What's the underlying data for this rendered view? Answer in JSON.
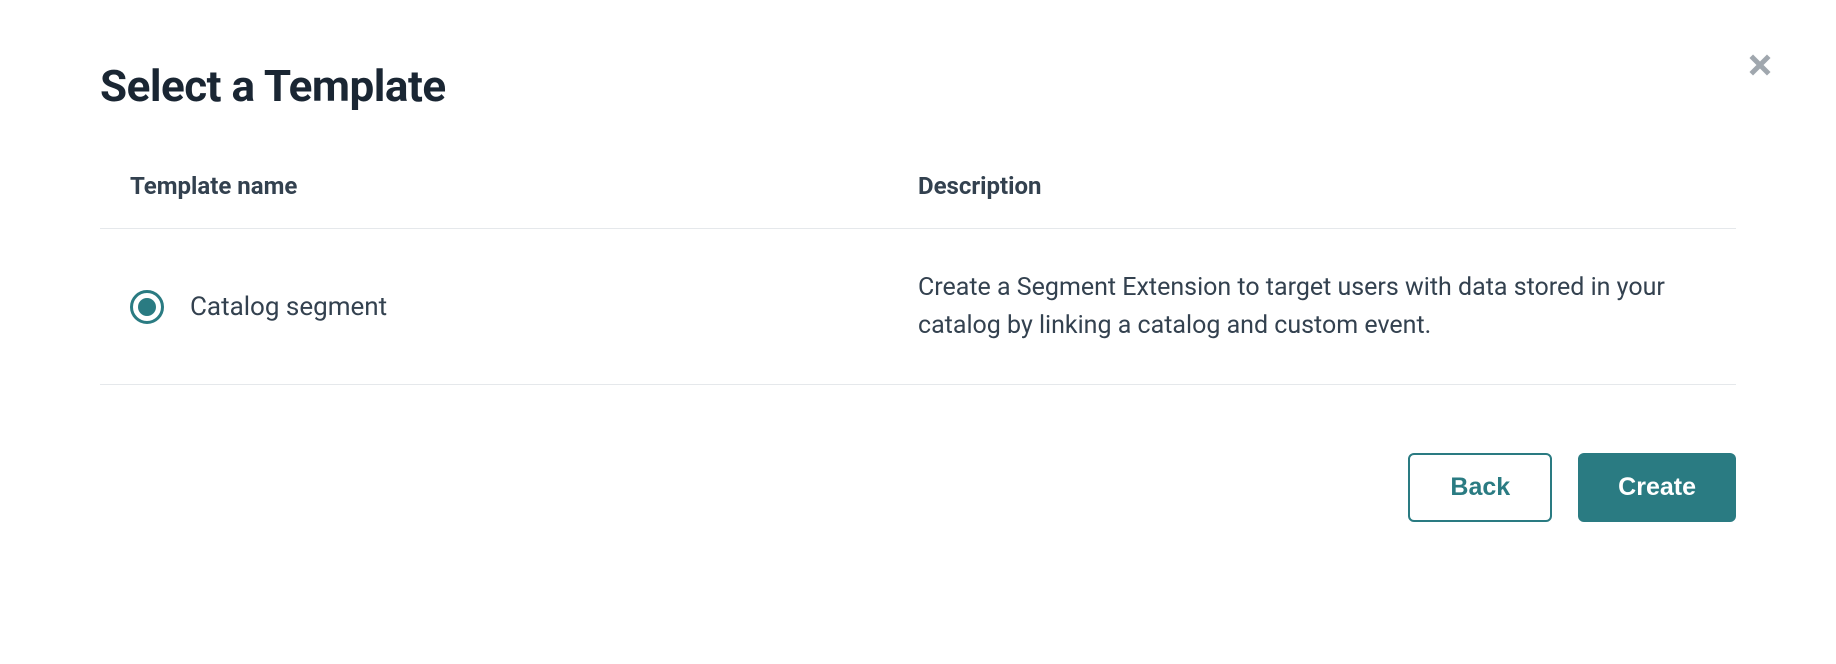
{
  "modal": {
    "title": "Select a Template",
    "columns": {
      "name": "Template name",
      "description": "Description"
    },
    "templates": [
      {
        "name": "Catalog segment",
        "description": "Create a Segment Extension to target users with data stored in your catalog by linking a catalog and custom event.",
        "selected": true
      }
    ],
    "buttons": {
      "back": "Back",
      "create": "Create"
    }
  }
}
